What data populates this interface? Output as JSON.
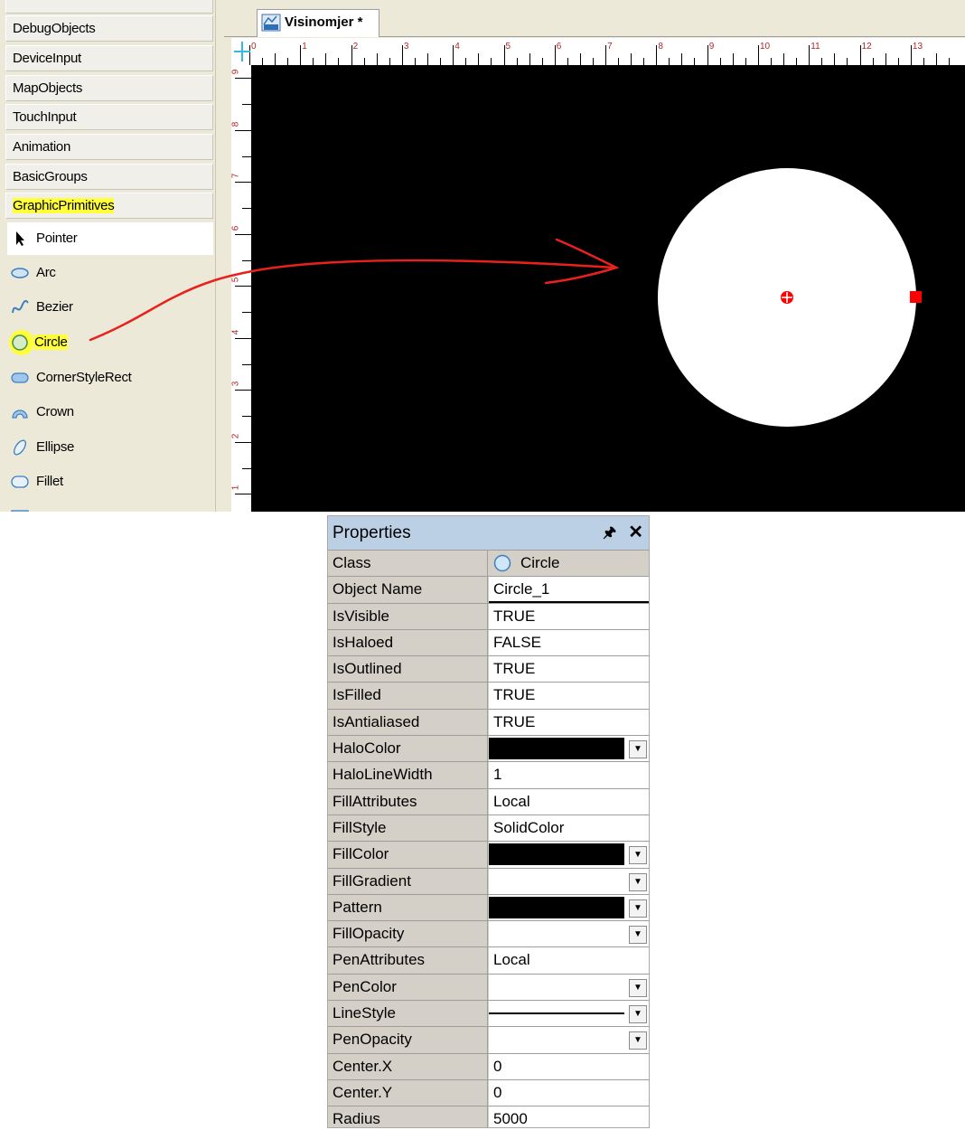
{
  "toolbox": {
    "categories": [
      {
        "label": "DebugObjects"
      },
      {
        "label": "DeviceInput"
      },
      {
        "label": "MapObjects"
      },
      {
        "label": "TouchInput"
      },
      {
        "label": "Animation"
      },
      {
        "label": "BasicGroups"
      },
      {
        "label": "GraphicPrimitives",
        "highlighted": true
      }
    ],
    "tools": [
      {
        "label": "Pointer",
        "icon": "pointer-arrow-icon"
      },
      {
        "label": "Arc",
        "icon": "arc-icon"
      },
      {
        "label": "Bezier",
        "icon": "bezier-icon"
      },
      {
        "label": "Circle",
        "icon": "circle-icon",
        "highlighted": true
      },
      {
        "label": "CornerStyleRect",
        "icon": "corner-style-rect-icon"
      },
      {
        "label": "Crown",
        "icon": "crown-icon"
      },
      {
        "label": "Ellipse",
        "icon": "ellipse-icon"
      },
      {
        "label": "Fillet",
        "icon": "fillet-icon"
      }
    ]
  },
  "editor": {
    "tab_label": "Visinomjer *",
    "ruler_top": [
      "0",
      "1",
      "2",
      "3",
      "4",
      "5",
      "6",
      "7",
      "8",
      "9",
      "10",
      "11",
      "12",
      "13"
    ],
    "ruler_left": [
      "9",
      "8",
      "7",
      "6",
      "5",
      "4",
      "3",
      "2",
      "1"
    ],
    "colors": {
      "canvas": "#000000",
      "circle": "#ffffff",
      "handles": "#ff0000",
      "annotation": "#e8211c"
    }
  },
  "properties": {
    "title": "Properties",
    "pin_icon": "pin-icon",
    "close_icon": "close-icon",
    "rows": [
      {
        "key": "Class",
        "value": "Circle",
        "class_icon": "circle-icon"
      },
      {
        "key": "Object Name",
        "value": "Circle_1"
      },
      {
        "key": "IsVisible",
        "value": "TRUE"
      },
      {
        "key": "IsHaloed",
        "value": "FALSE"
      },
      {
        "key": "IsOutlined",
        "value": "TRUE"
      },
      {
        "key": "IsFilled",
        "value": "TRUE"
      },
      {
        "key": "IsAntialiased",
        "value": "TRUE"
      },
      {
        "key": "HaloColor",
        "value": "",
        "swatch": "#000000",
        "dropdown": true
      },
      {
        "key": "HaloLineWidth",
        "value": "1"
      },
      {
        "key": "FillAttributes",
        "value": "Local"
      },
      {
        "key": "FillStyle",
        "value": "SolidColor"
      },
      {
        "key": "FillColor",
        "value": "",
        "swatch": "#000000",
        "dropdown": true
      },
      {
        "key": "FillGradient",
        "value": "",
        "swatch": "#ffffff",
        "dropdown": true
      },
      {
        "key": "Pattern",
        "value": "",
        "swatch": "#000000",
        "dropdown": true
      },
      {
        "key": "FillOpacity",
        "value": "",
        "swatch": "#ffffff",
        "dropdown": true
      },
      {
        "key": "PenAttributes",
        "value": "Local"
      },
      {
        "key": "PenColor",
        "value": "",
        "swatch": "#ffffff",
        "dropdown": true
      },
      {
        "key": "LineStyle",
        "value": "",
        "line": true,
        "dropdown": true
      },
      {
        "key": "PenOpacity",
        "value": "",
        "swatch": "#ffffff",
        "dropdown": true
      },
      {
        "key": "Center.X",
        "value": "0"
      },
      {
        "key": "Center.Y",
        "value": "0"
      },
      {
        "key": "Radius",
        "value": "5000"
      }
    ]
  }
}
